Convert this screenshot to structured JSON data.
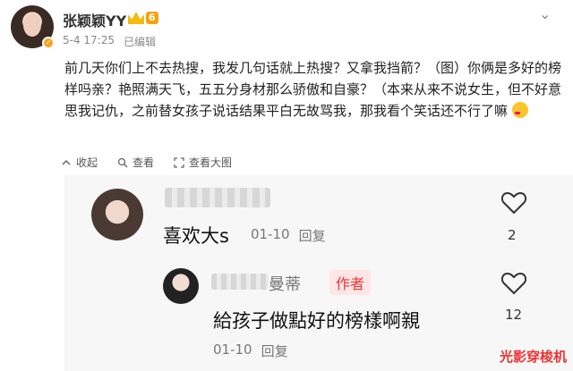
{
  "post": {
    "username": "张颖颖YY",
    "vip_level": "6",
    "time": "5-4 17:25",
    "edited": "已编辑",
    "more": "⌄",
    "text": "前几天你们上不去热搜，我发几句话就上热搜？又拿我挡箭？（图）你俩是多好的榜样吗亲？艳照满天飞，五五分身材那么骄傲和自豪？（本来从来不说女生，但不好意思我记仇，之前替女孩子说话结果平白无故骂我，那我看个笑话还不行了嘛",
    "actions": {
      "favorite": "收起",
      "repost": "查看",
      "view": "查看大图"
    }
  },
  "comments": {
    "comment1": {
      "text": "喜欢大s",
      "time": "01-10",
      "reply": "回复",
      "likes": "2"
    },
    "comment2": {
      "name": "曼蒂",
      "author_tag": "作者",
      "text": "給孩子做點好的榜樣啊親",
      "time": "01-10",
      "reply": "回复",
      "likes": "12"
    },
    "watermark": "光影穿梭机"
  }
}
